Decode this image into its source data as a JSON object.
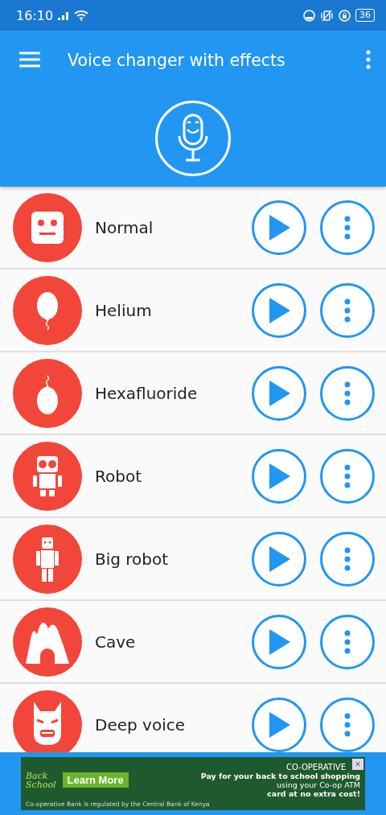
{
  "status_bar": {
    "time": "16:10",
    "battery": "36"
  },
  "app_bar": {
    "title": "Voice changer with effects"
  },
  "effects": [
    {
      "name": "Normal",
      "kind": "normal"
    },
    {
      "name": "Helium",
      "kind": "helium"
    },
    {
      "name": "Hexafluoride",
      "kind": "hexafluoride"
    },
    {
      "name": "Robot",
      "kind": "robot"
    },
    {
      "name": "Big robot",
      "kind": "big-robot"
    },
    {
      "name": "Cave",
      "kind": "cave"
    },
    {
      "name": "Deep voice",
      "kind": "deep-voice"
    }
  ],
  "ad": {
    "logo_line_1": "Back",
    "logo_line_2": "School",
    "button": "Learn More",
    "brand": "CO-OPERATIVE",
    "headline": "Pay for your back to school shopping",
    "line_2": "using your Co-op ATM",
    "line_3": "card at no extra cost!",
    "footer": "Co-operative Bank is regulated by the Central Bank of Kenya",
    "close": "×"
  }
}
